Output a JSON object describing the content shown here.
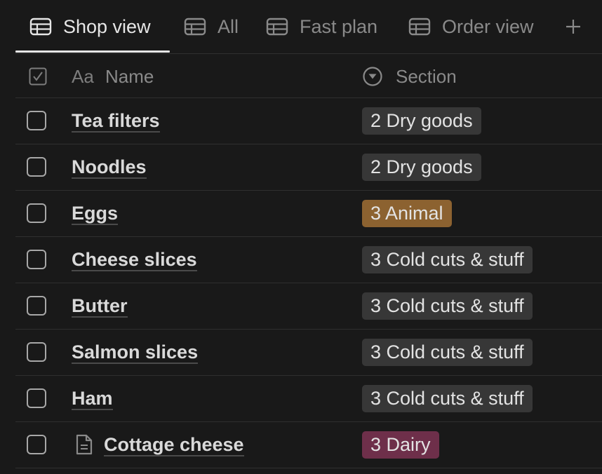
{
  "tabs": [
    {
      "label": "Shop view",
      "active": true
    },
    {
      "label": "All",
      "active": false
    },
    {
      "label": "Fast plan",
      "active": false
    },
    {
      "label": "Order view",
      "active": false
    }
  ],
  "add_tab_icon": "plus-icon",
  "columns": {
    "name_icon": "Aa",
    "name_label": "Name",
    "section_label": "Section"
  },
  "rows": [
    {
      "name": "Tea filters",
      "section": "2 Dry goods",
      "color": "#373737",
      "checked": false
    },
    {
      "name": "Noodles",
      "section": "2 Dry goods",
      "color": "#373737",
      "checked": false
    },
    {
      "name": "Eggs",
      "section": "3 Animal",
      "color": "#8c6230",
      "checked": false
    },
    {
      "name": "Cheese slices",
      "section": "3 Cold cuts & stuff",
      "color": "#373737",
      "checked": false
    },
    {
      "name": "Butter",
      "section": "3 Cold cuts & stuff",
      "color": "#373737",
      "checked": false
    },
    {
      "name": "Salmon slices",
      "section": "3 Cold cuts & stuff",
      "color": "#373737",
      "checked": false
    },
    {
      "name": "Ham",
      "section": "3 Cold cuts & stuff",
      "color": "#373737",
      "checked": false
    },
    {
      "name": "Cottage cheese",
      "section": "3 Dairy",
      "color": "#6e2f4a",
      "checked": false,
      "has_page_icon": true
    }
  ],
  "colors": {
    "background": "#191919",
    "pill_default": "#373737",
    "pill_brown": "#8c6230",
    "pill_pink": "#6e2f4a"
  }
}
